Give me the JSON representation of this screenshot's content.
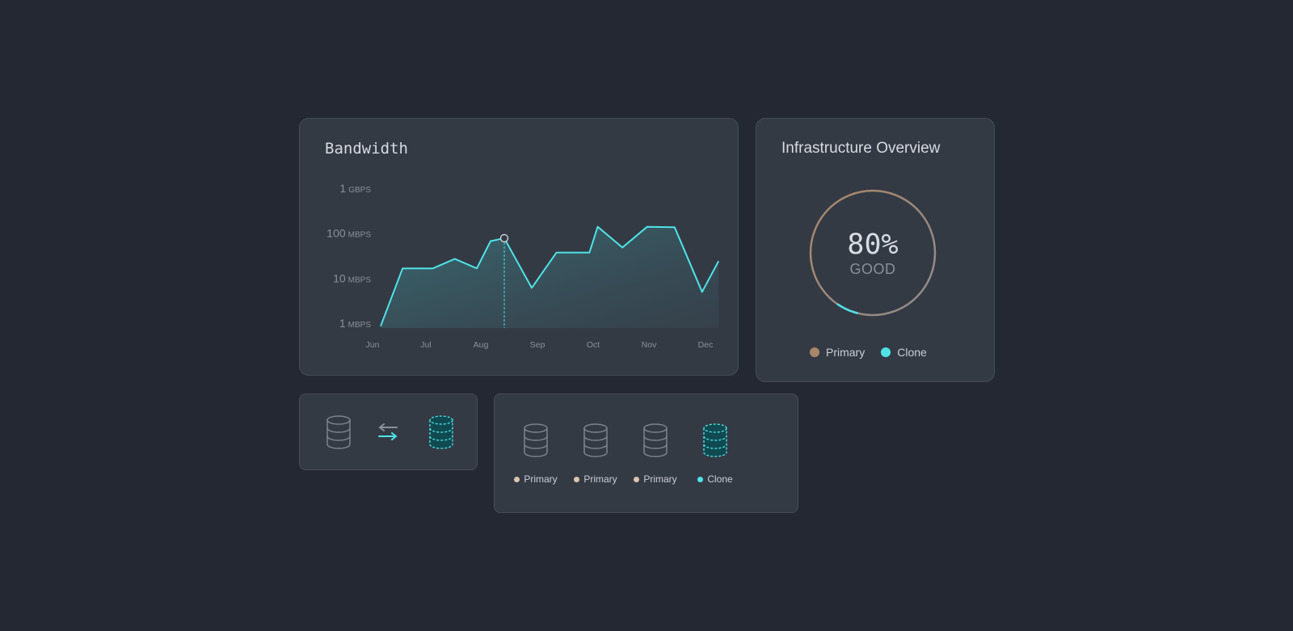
{
  "bandwidth": {
    "title": "Bandwidth"
  },
  "chart_data": {
    "type": "area",
    "title": "Bandwidth",
    "xlabel": "",
    "ylabel": "",
    "y_scale": "log",
    "y_ticks": [
      {
        "value": 1,
        "label": "1",
        "unit": "MBPS"
      },
      {
        "value": 10,
        "label": "10",
        "unit": "MBPS"
      },
      {
        "value": 100,
        "label": "100",
        "unit": "MBPS"
      },
      {
        "value": 1000,
        "label": "1",
        "unit": "GBPS"
      }
    ],
    "x_ticks": [
      "Jun",
      "Jul",
      "Aug",
      "Sep",
      "Oct",
      "Nov",
      "Dec"
    ],
    "ylim": [
      1,
      1000
    ],
    "points": [
      {
        "x": 0.0,
        "y": 1.1
      },
      {
        "x": 0.4,
        "y": 22
      },
      {
        "x": 0.95,
        "y": 22
      },
      {
        "x": 1.35,
        "y": 36
      },
      {
        "x": 1.75,
        "y": 22
      },
      {
        "x": 2.0,
        "y": 90
      },
      {
        "x": 2.25,
        "y": 105
      },
      {
        "x": 2.75,
        "y": 8
      },
      {
        "x": 3.2,
        "y": 50
      },
      {
        "x": 3.8,
        "y": 50
      },
      {
        "x": 3.95,
        "y": 190
      },
      {
        "x": 4.4,
        "y": 65
      },
      {
        "x": 4.85,
        "y": 190
      },
      {
        "x": 5.35,
        "y": 185
      },
      {
        "x": 5.85,
        "y": 6.5
      },
      {
        "x": 6.15,
        "y": 32
      }
    ],
    "highlight_index": 6,
    "colors": {
      "line": "#4fe3e8",
      "fill": "#3f8f95",
      "label": "#8a909a"
    }
  },
  "infra": {
    "title": "Infrastructure Overview",
    "gauge": {
      "value_text": "80%",
      "status": "GOOD",
      "primary_fraction": 0.8,
      "clone_fraction": 0.2
    },
    "legend": [
      {
        "label": "Primary",
        "color": "#a98669"
      },
      {
        "label": "Clone",
        "color": "#4fe3e8"
      }
    ]
  },
  "sync": {
    "primary_icon": "database-icon",
    "arrows_icon": "swap-arrows-icon",
    "clone_icon": "database-clone-icon"
  },
  "databases": {
    "items": [
      {
        "label": "Primary",
        "type": "primary",
        "dot_color": "#dcc4ae"
      },
      {
        "label": "Primary",
        "type": "primary",
        "dot_color": "#dcc4ae"
      },
      {
        "label": "Primary",
        "type": "primary",
        "dot_color": "#dcc4ae"
      },
      {
        "label": "Clone",
        "type": "clone",
        "dot_color": "#4fe3e8"
      }
    ]
  },
  "colors": {
    "background": "#242833",
    "card": "#343a44",
    "accent": "#4fe3e8",
    "primary": "#a98669"
  }
}
